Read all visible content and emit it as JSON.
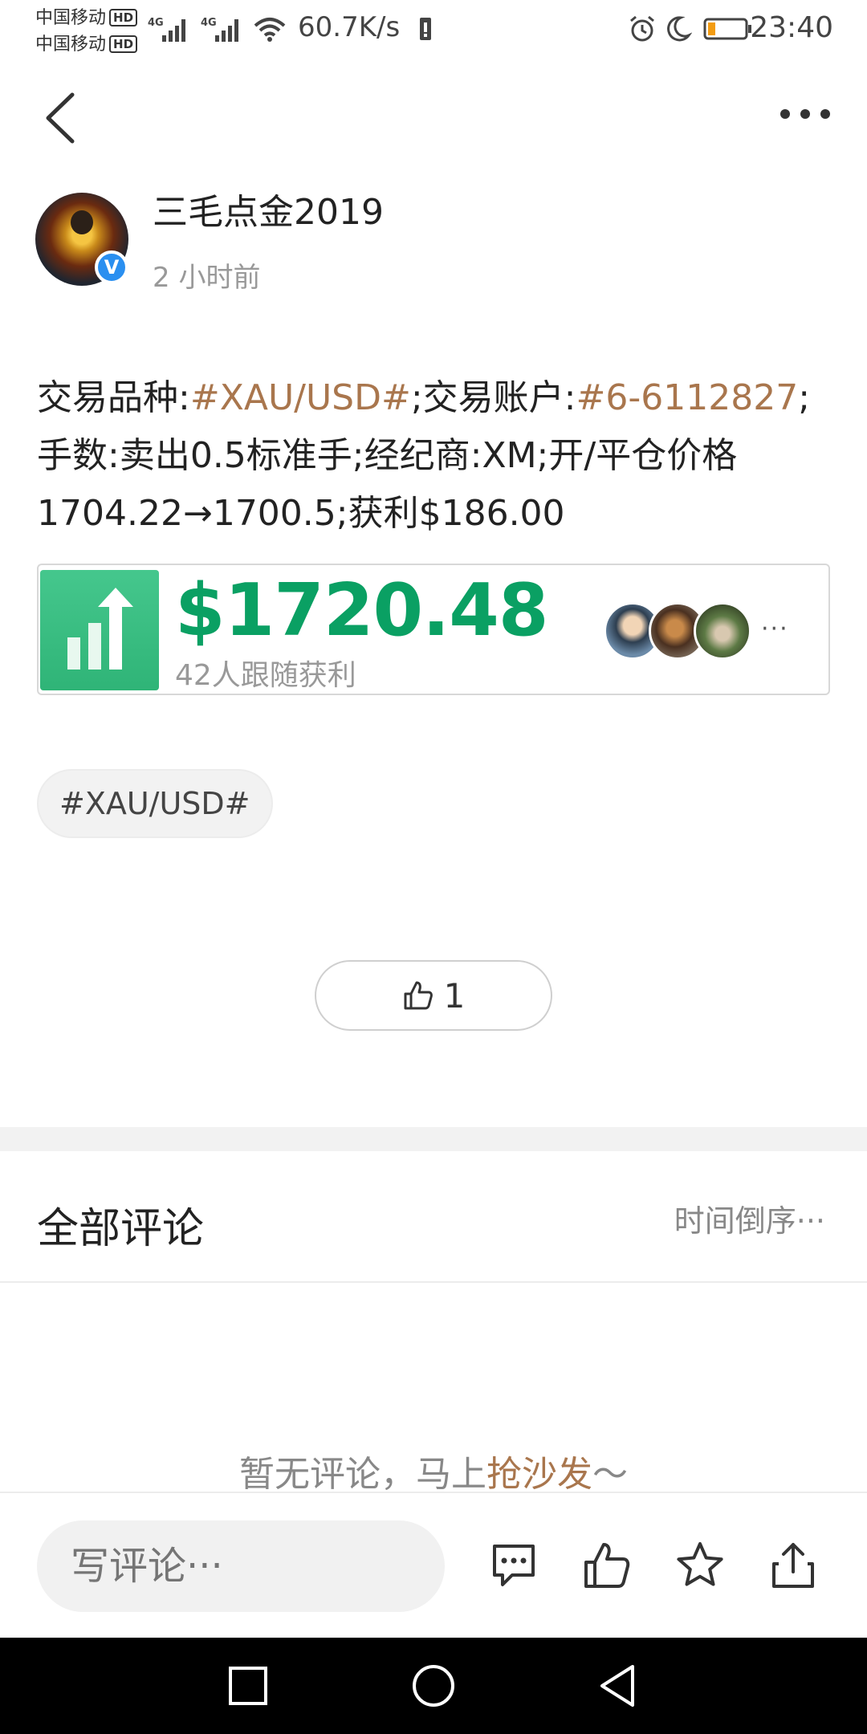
{
  "status_bar": {
    "carrier1": "中国移动",
    "carrier2": "中国移动",
    "hd_badge": "HD",
    "network_type": "4G",
    "net_speed": "60.7K/s",
    "time": "23:40",
    "icons": [
      "signal-icon",
      "wifi-icon",
      "battery-saver-icon",
      "alarm-icon",
      "do-not-disturb-icon",
      "battery-icon"
    ]
  },
  "header": {
    "back_icon": "chevron-left-icon",
    "more_icon": "more-horizontal-icon"
  },
  "post": {
    "author": "三毛点金2019",
    "verified_mark": "V",
    "time_ago": "2 小时前",
    "text": {
      "part1": "交易品种:",
      "symbol_link": "#XAU/USD#",
      "part2": ";交易账户:",
      "account_link": "#6-6112827",
      "part3": ";手数:卖出0.5标准手;经纪商:XM;开/平仓价格1704.22→1700.5;获利$186.00"
    },
    "profit_card": {
      "amount": "$1720.48",
      "subtitle": "42人跟随获利",
      "more": "···",
      "icon": "bar-chart-up-icon"
    },
    "topic_chip": "#XAU/USD#",
    "like_count": "1"
  },
  "comments": {
    "title": "全部评论",
    "sort_label": "时间倒序···",
    "empty_prefix": "暂无评论，马上",
    "empty_link": "抢沙发",
    "empty_suffix": "～"
  },
  "bottom_bar": {
    "input_placeholder": "写评论···",
    "icons": [
      "comment-icon",
      "thumbs-up-icon",
      "star-icon",
      "share-icon"
    ]
  },
  "nav_bar": {
    "icons": [
      "recent-apps-icon",
      "home-icon",
      "back-icon"
    ]
  },
  "colors": {
    "link": "#a9764d",
    "profit_green": "#0aa063",
    "card_icon_green": "#3dbd84"
  }
}
